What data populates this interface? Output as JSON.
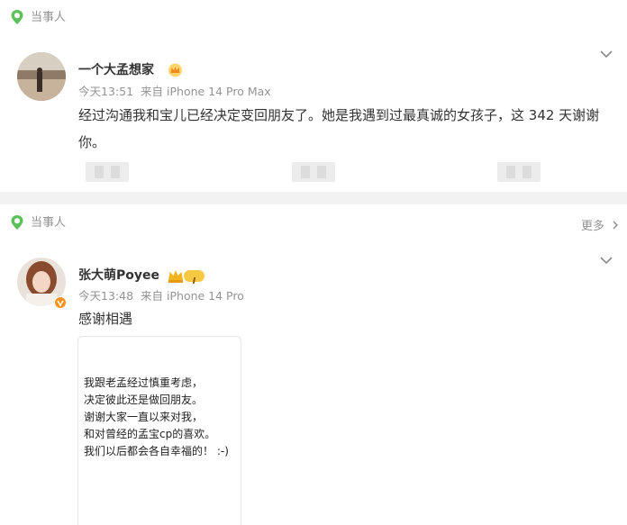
{
  "accent": "#52b84a",
  "posts": [
    {
      "tag_label": "当事人",
      "username": "一个大孟想家",
      "time": "今天13:51",
      "source": "来自 iPhone 14 Pro Max",
      "text_line1": "经过沟通我和宝儿已经决定变回朋友了。她是我遇到过最真诚的女孩子，这 342 天谢谢",
      "text_line2": "你。"
    },
    {
      "tag_label": "当事人",
      "more_label": "更多",
      "username": "张大萌Poyee",
      "badge_level": "I",
      "time": "今天13:48",
      "source": "来自 iPhone 14 Pro",
      "text": "感谢相遇",
      "card_lines": [
        "我跟老孟经过慎重考虑，",
        "决定彼此还是做回朋友。",
        "谢谢大家一直以来对我，",
        "和对曾经的孟宝cp的喜欢。",
        "我们以后都会各自幸福的！ :-)"
      ]
    }
  ]
}
